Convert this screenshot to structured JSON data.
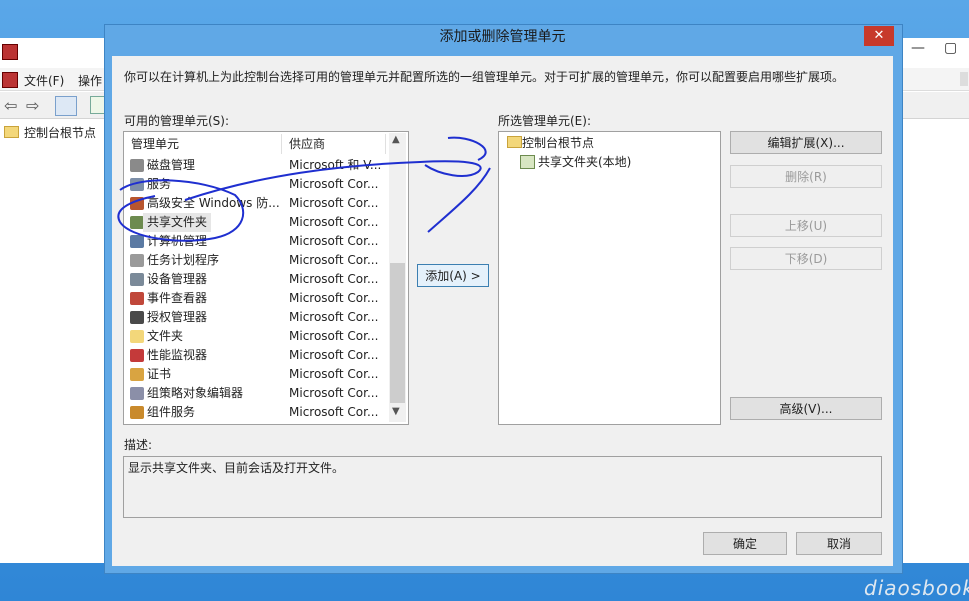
{
  "background_window": {
    "menu_file": "文件(F)",
    "menu_action": "操作",
    "tree_root": "控制台根节点"
  },
  "dialog": {
    "title": "添加或删除管理单元",
    "close_glyph": "✕",
    "intro": "你可以在计算机上为此控制台选择可用的管理单元并配置所选的一组管理单元。对于可扩展的管理单元，你可以配置要启用哪些扩展项。",
    "available_label": "可用的管理单元(S):",
    "selected_label": "所选管理单元(E):",
    "columns": {
      "name": "管理单元",
      "vendor": "供应商"
    },
    "available": [
      {
        "name": "磁盘管理",
        "vendor": "Microsoft 和 V...",
        "icon": "disk-icon",
        "color": "#8a8a8a"
      },
      {
        "name": "服务",
        "vendor": "Microsoft Cor...",
        "icon": "services-icon",
        "color": "#7d8fa8"
      },
      {
        "name": "高级安全 Windows 防...",
        "vendor": "Microsoft Cor...",
        "icon": "firewall-icon",
        "color": "#b8552e"
      },
      {
        "name": "共享文件夹",
        "vendor": "Microsoft Cor...",
        "icon": "shared-folder-icon",
        "color": "#6d8b4f"
      },
      {
        "name": "计算机管理",
        "vendor": "Microsoft Cor...",
        "icon": "computer-management-icon",
        "color": "#5b7aa3"
      },
      {
        "name": "任务计划程序",
        "vendor": "Microsoft Cor...",
        "icon": "clock-icon",
        "color": "#9a9a9a"
      },
      {
        "name": "设备管理器",
        "vendor": "Microsoft Cor...",
        "icon": "device-manager-icon",
        "color": "#7b8a99"
      },
      {
        "name": "事件查看器",
        "vendor": "Microsoft Cor...",
        "icon": "event-viewer-icon",
        "color": "#c0473a"
      },
      {
        "name": "授权管理器",
        "vendor": "Microsoft Cor...",
        "icon": "authorization-icon",
        "color": "#4a4a4a"
      },
      {
        "name": "文件夹",
        "vendor": "Microsoft Cor...",
        "icon": "folder-icon",
        "color": "#f3d77a"
      },
      {
        "name": "性能监视器",
        "vendor": "Microsoft Cor...",
        "icon": "performance-icon",
        "color": "#c43a3a"
      },
      {
        "name": "证书",
        "vendor": "Microsoft Cor...",
        "icon": "certificate-icon",
        "color": "#d9a441"
      },
      {
        "name": "组策略对象编辑器",
        "vendor": "Microsoft Cor...",
        "icon": "group-policy-icon",
        "color": "#8b8fa8"
      },
      {
        "name": "组件服务",
        "vendor": "Microsoft Cor...",
        "icon": "component-services-icon",
        "color": "#c98a2c"
      }
    ],
    "selected_root": "控制台根节点",
    "selected_child": "共享文件夹(本地)",
    "add_button": "添加(A) >",
    "edit_extensions": "编辑扩展(X)...",
    "remove": "删除(R)",
    "move_up": "上移(U)",
    "move_down": "下移(D)",
    "advanced": "高级(V)...",
    "description_label": "描述:",
    "description": "显示共享文件夹、目前会话及打开文件。",
    "ok": "确定",
    "cancel": "取消"
  },
  "watermark": "diaosbook"
}
